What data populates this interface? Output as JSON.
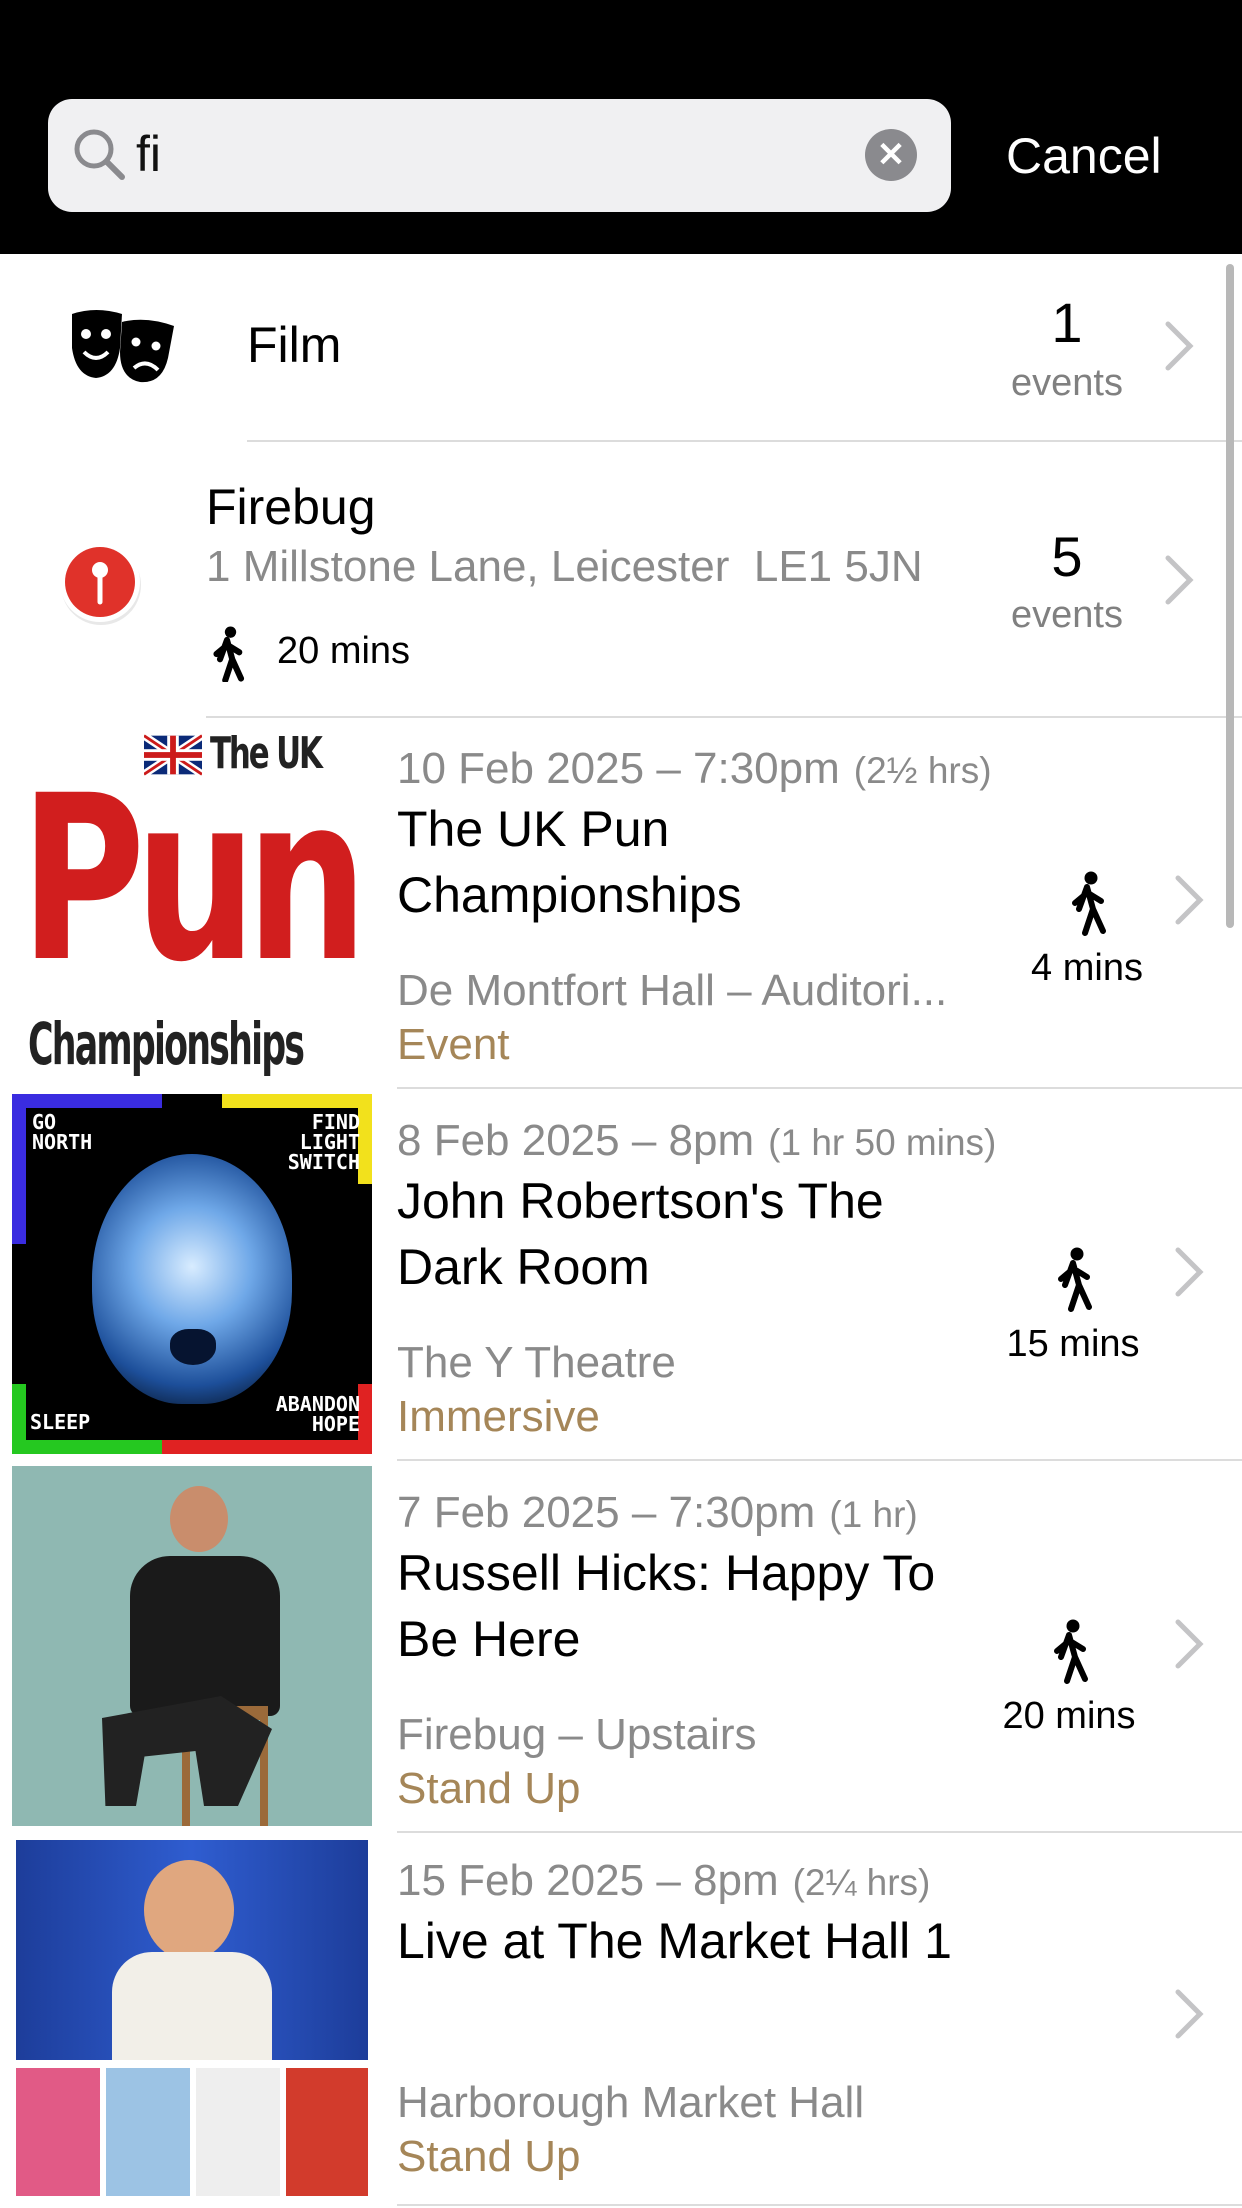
{
  "search": {
    "query": "fi",
    "cancel_label": "Cancel"
  },
  "category": {
    "name": "Film",
    "count": "1",
    "count_label": "events"
  },
  "venue": {
    "name": "Firebug",
    "address": "1 Millstone Lane, Leicester  LE1 5JN",
    "walk": "20 mins",
    "count": "5",
    "count_label": "events"
  },
  "events": [
    {
      "date": "10 Feb 2025 – 7:30pm",
      "duration": "(2½ hrs)",
      "title": "The UK Pun Championships",
      "venue": "De Montfort Hall – Auditori...",
      "category": "Event",
      "walk": "4 mins",
      "poster": {
        "top": "The UK",
        "main": "Pun",
        "bottom": "Championships"
      }
    },
    {
      "date": "8 Feb 2025 – 8pm",
      "duration": "(1 hr 50 mins)",
      "title": "John Robertson's The Dark Room",
      "venue": "The Y Theatre",
      "category": "Immersive",
      "walk": "15 mins",
      "poster": {
        "tl": "GO NORTH",
        "tr": "FIND LIGHT SWITCH",
        "bl": "SLEEP",
        "br": "ABANDON HOPE"
      }
    },
    {
      "date": "7 Feb 2025 – 7:30pm",
      "duration": "(1 hr)",
      "title": "Russell Hicks: Happy To Be Here",
      "venue": "Firebug – Upstairs",
      "category": "Stand Up",
      "walk": "20 mins"
    },
    {
      "date": "15 Feb 2025 – 8pm",
      "duration": "(2¼ hrs)",
      "title": "Live at The Market Hall 1",
      "venue": "Harborough Market Hall",
      "category": "Stand Up",
      "walk": ""
    }
  ],
  "colors": {
    "accent_category": "#a58658",
    "secondary_text": "#8a8a8a",
    "pin_red": "#e0322a"
  }
}
